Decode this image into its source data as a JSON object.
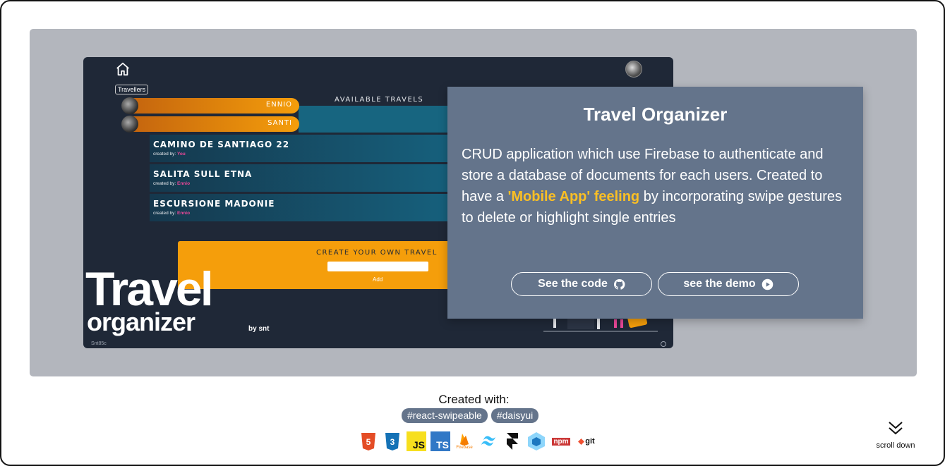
{
  "preview": {
    "travellers_label": "Travellers",
    "available_title": "AVAILABLE TRAVELS",
    "travellers": [
      {
        "name": "ENNIO"
      },
      {
        "name": "SANTI"
      }
    ],
    "travels": [
      {
        "name": "CAMINO DE SANTIAGO 22",
        "created_by_label": "created by:",
        "author": "You"
      },
      {
        "name": "SALITA SULL ETNA",
        "created_by_label": "created by:",
        "author": "Ennio"
      },
      {
        "name": "ESCURSIONE MADONIE",
        "created_by_label": "created by:",
        "author": "Ennio"
      }
    ],
    "create_title": "CREATE YOUR OWN TRAVEL",
    "add_label": "Add",
    "logo_main": "Travel",
    "logo_sub": "organizer",
    "logo_by": "by snt",
    "footer_signature": "Snt85c"
  },
  "card": {
    "title": "Travel Organizer",
    "desc_before": "CRUD application which use Firebase to authenticate and store a database of documents for each users. Created to have a ",
    "desc_highlight": "'Mobile App' feeling",
    "desc_after": " by incorporating swipe gestures to delete or highlight single entries",
    "code_button": "See the code",
    "demo_button": "see the demo"
  },
  "created_with": {
    "label": "Created with:",
    "tags": [
      "#react-swipeable",
      "#daisyui"
    ],
    "icons": [
      "html5-icon",
      "css3-icon",
      "javascript-icon",
      "typescript-icon",
      "firebase-icon",
      "tailwind-icon",
      "framer-icon",
      "webpack-icon",
      "npm-icon",
      "git-icon"
    ],
    "firebase_label": "Firebase",
    "js_label": "JS",
    "ts_label": "TS",
    "npm_label": "npm",
    "git_label": "git"
  },
  "scroll": {
    "label": "scroll down"
  },
  "colors": {
    "panel": "#b3b6bd",
    "card": "#64748b",
    "highlight": "#fbbf24",
    "orange": "#f59e0b",
    "dark": "#1f2837"
  }
}
